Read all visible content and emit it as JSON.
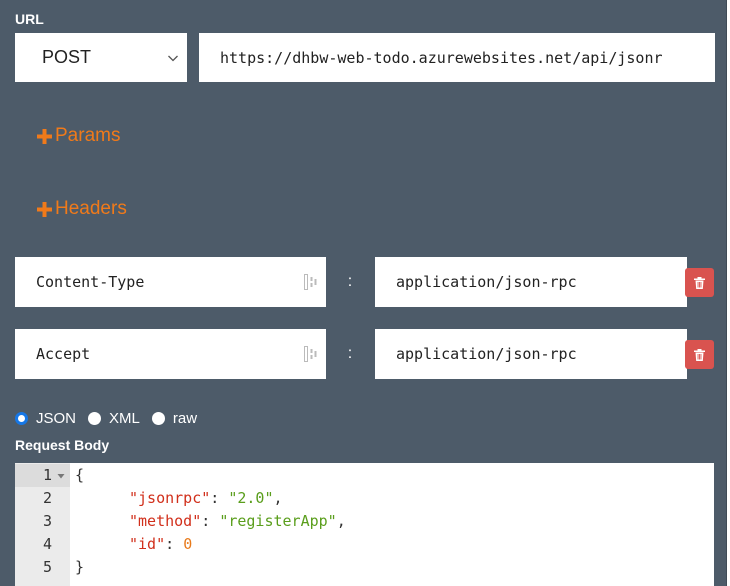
{
  "request": {
    "url_label": "URL",
    "method": "POST",
    "url": "https://dhbw-web-todo.azurewebsites.net/api/jsonr"
  },
  "toggles": {
    "params_label": "Params",
    "headers_label": "Headers"
  },
  "headers": [
    {
      "key": "Content-Type",
      "value": "application/json-rpc"
    },
    {
      "key": "Accept",
      "value": "application/json-rpc"
    }
  ],
  "separator": ":",
  "body_types": [
    {
      "label": "JSON",
      "selected": true
    },
    {
      "label": "XML",
      "selected": false
    },
    {
      "label": "raw",
      "selected": false
    }
  ],
  "request_body_label": "Request Body",
  "editor": {
    "line_numbers": [
      "1",
      "2",
      "3",
      "4",
      "5"
    ],
    "lines": {
      "l1_open": "{",
      "l2_key": "\"jsonrpc\"",
      "l2_colon": ": ",
      "l2_value": "\"2.0\"",
      "l2_comma": ",",
      "l3_key": "\"method\"",
      "l3_colon": ": ",
      "l3_value": "\"registerApp\"",
      "l3_comma": ",",
      "l4_key": "\"id\"",
      "l4_colon": ": ",
      "l4_value": "0",
      "l5_close": "}"
    }
  },
  "icons": {
    "select_chevron": "chevron-down-icon",
    "add": "plus-icon",
    "sort": "drag-handle-icon",
    "delete": "trash-icon",
    "fold": "fold-arrow-icon"
  },
  "colors": {
    "panel_background": "#4d5b69",
    "accent_orange": "#f07a1a",
    "delete_red": "#d9534f",
    "radio_blue": "#1677e6",
    "json_key": "#d12f1b",
    "json_string": "#5a9e1c",
    "json_number": "#e87a1b"
  }
}
